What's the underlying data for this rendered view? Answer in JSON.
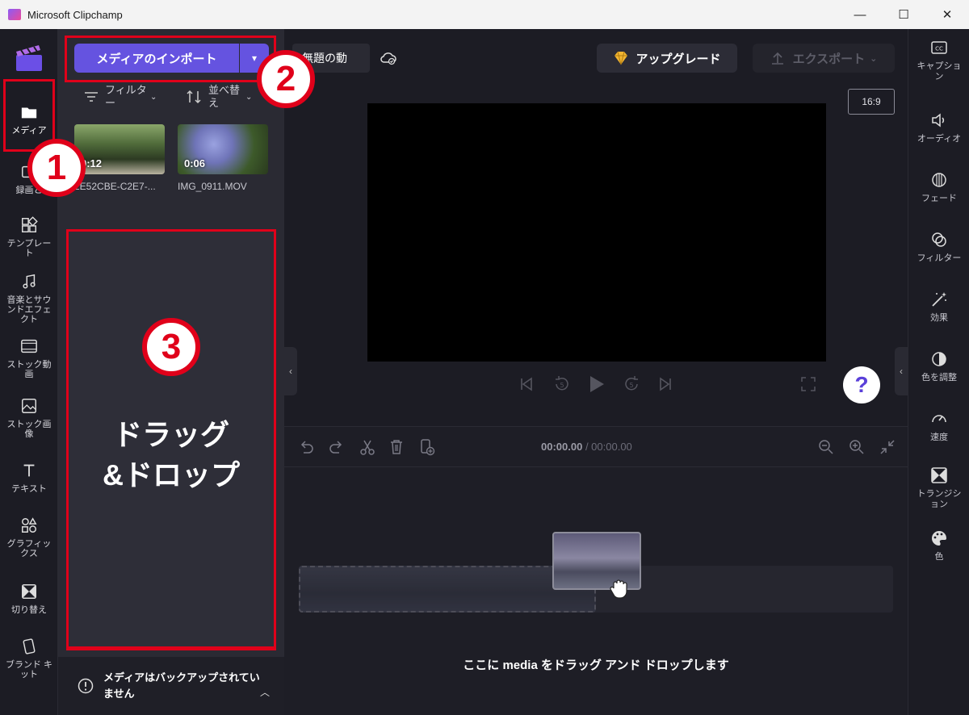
{
  "window": {
    "title": "Microsoft Clipchamp",
    "minimize": "—",
    "maximize": "☐",
    "close": "✕"
  },
  "leftnav": {
    "items": [
      {
        "label": "メディア",
        "icon": "folder-icon"
      },
      {
        "label": "録画と",
        "icon": "record-icon"
      },
      {
        "label": "テンプレート",
        "icon": "template-icon"
      },
      {
        "label": "音楽とサウンドエフェクト",
        "icon": "music-icon"
      },
      {
        "label": "ストック動画",
        "icon": "film-icon"
      },
      {
        "label": "ストック画像",
        "icon": "image-icon"
      },
      {
        "label": "テキスト",
        "icon": "text-icon"
      },
      {
        "label": "グラフィックス",
        "icon": "shapes-icon"
      },
      {
        "label": "切り替え",
        "icon": "transition-icon"
      },
      {
        "label": "ブランド キット",
        "icon": "brand-kit-icon"
      }
    ]
  },
  "media": {
    "import_label": "メディアのインポート",
    "filter_label": "フィルター",
    "sort_label": "並べ替え",
    "thumbs": [
      {
        "duration": "0:12",
        "name": "2E52CBE-C2E7-..."
      },
      {
        "duration": "0:06",
        "name": "IMG_0911.MOV"
      }
    ],
    "dropzone_text": "ドラッグ\n&ドロップ",
    "backup_note": "メディアはバックアップされていません"
  },
  "toolbar": {
    "project_name": "無題の動",
    "upgrade_label": "アップグレード",
    "export_label": "エクスポート",
    "aspect_ratio": "16:9"
  },
  "help_label": "?",
  "timeline": {
    "current_time": "00:00.00",
    "total_time": "/ 00:00.00",
    "drop_hint": "ここに media をドラッグ アンド ドロップします"
  },
  "rightnav": {
    "items": [
      {
        "label": "キャプション",
        "icon": "captions-icon"
      },
      {
        "label": "オーディオ",
        "icon": "speaker-icon"
      },
      {
        "label": "フェード",
        "icon": "fade-icon"
      },
      {
        "label": "フィルター",
        "icon": "filter-icon"
      },
      {
        "label": "効果",
        "icon": "magic-wand-icon"
      },
      {
        "label": "色を調整",
        "icon": "contrast-icon"
      },
      {
        "label": "速度",
        "icon": "speedometer-icon"
      },
      {
        "label": "トランジション",
        "icon": "transition-icon"
      },
      {
        "label": "色",
        "icon": "palette-icon"
      }
    ]
  },
  "annotations": {
    "one": "1",
    "two": "2",
    "three": "3"
  },
  "colors": {
    "accent": "#6553e0",
    "annotation_red": "#e0001a",
    "background": "#1c1c24",
    "panel": "#2a2a33"
  }
}
